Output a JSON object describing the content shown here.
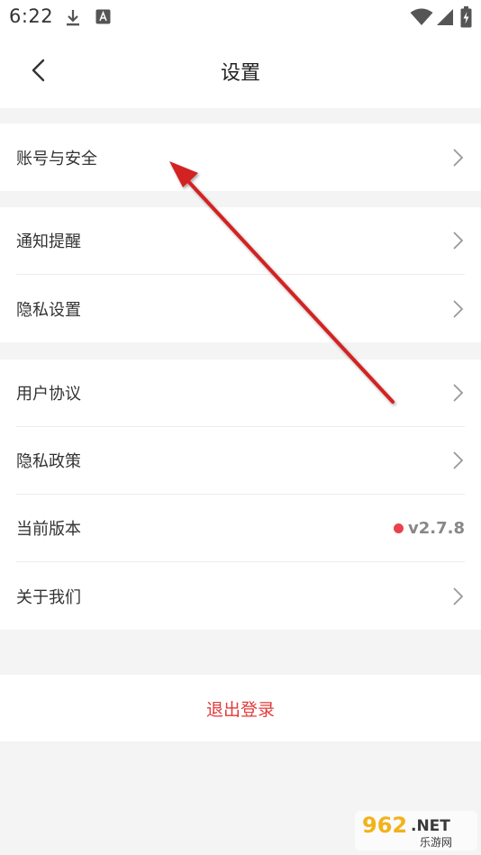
{
  "status_bar": {
    "time": "6:22",
    "icons": [
      "download-icon",
      "font-icon",
      "wifi-icon",
      "signal-icon",
      "battery-charging-icon"
    ]
  },
  "nav": {
    "title": "设置",
    "back_icon": "chevron-left-icon"
  },
  "groups": [
    {
      "items": [
        {
          "label": "账号与安全",
          "accessory": "chevron"
        }
      ]
    },
    {
      "items": [
        {
          "label": "通知提醒",
          "accessory": "chevron"
        },
        {
          "label": "隐私设置",
          "accessory": "chevron"
        }
      ]
    },
    {
      "items": [
        {
          "label": "用户协议",
          "accessory": "chevron"
        },
        {
          "label": "隐私政策",
          "accessory": "chevron"
        },
        {
          "label": "当前版本",
          "accessory": "version",
          "value": "v2.7.8"
        },
        {
          "label": "关于我们",
          "accessory": "chevron"
        }
      ]
    }
  ],
  "logout": {
    "label": "退出登录"
  },
  "colors": {
    "accent_red": "#e23b3b",
    "version_dot": "#e9424c",
    "annotation_arrow": "#d32121",
    "background": "#f4f4f4"
  },
  "watermark": {
    "main": "962.NET",
    "sub": "乐游网"
  }
}
